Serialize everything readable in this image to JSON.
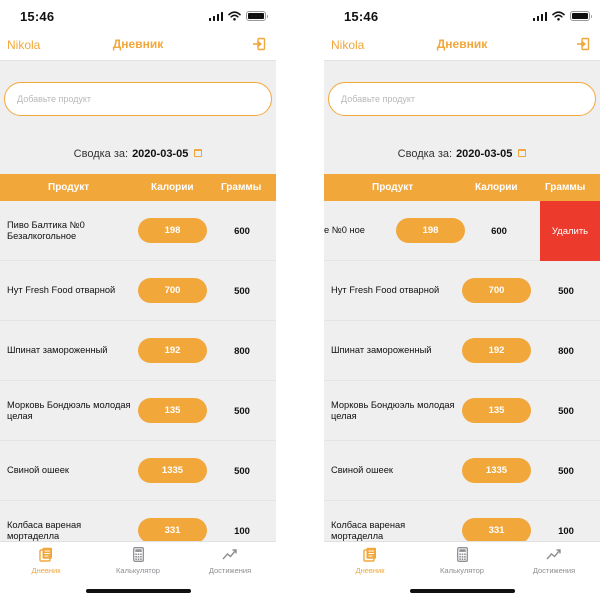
{
  "status_bar": {
    "time": "15:46"
  },
  "nav": {
    "user": "Nikola",
    "title": "Дневник"
  },
  "search": {
    "placeholder": "Добавьте продукт"
  },
  "summary": {
    "label": "Сводка за:",
    "date": "2020-03-05"
  },
  "table": {
    "headers": {
      "product": "Продукт",
      "calories": "Калории",
      "grams": "Граммы"
    }
  },
  "left_rows": [
    {
      "name": "Пиво Балтика №0 Безалкогольное",
      "calories": "198",
      "grams": "600"
    },
    {
      "name": "Нут Fresh Food отварной",
      "calories": "700",
      "grams": "500"
    },
    {
      "name": "Шпинат замороженный",
      "calories": "192",
      "grams": "800"
    },
    {
      "name": "Морковь Бондюэль молодая целая",
      "calories": "135",
      "grams": "500"
    },
    {
      "name": "Свиной ошеек",
      "calories": "1335",
      "grams": "500"
    },
    {
      "name": "Колбаса вареная мортаделла",
      "calories": "331",
      "grams": "100"
    }
  ],
  "right_rows": [
    {
      "name": "е №0 ное",
      "calories": "198",
      "grams": "600",
      "delete_label": "Удалить"
    },
    {
      "name": "Нут Fresh Food отварной",
      "calories": "700",
      "grams": "500"
    },
    {
      "name": "Шпинат замороженный",
      "calories": "192",
      "grams": "800"
    },
    {
      "name": "Морковь Бондюэль молодая целая",
      "calories": "135",
      "grams": "500"
    },
    {
      "name": "Свиной ошеек",
      "calories": "1335",
      "grams": "500"
    },
    {
      "name": "Колбаса вареная мортаделла",
      "calories": "331",
      "grams": "100"
    }
  ],
  "tabs": [
    {
      "label": "Дневник",
      "icon": "diary-icon",
      "active": true
    },
    {
      "label": "Калькулятор",
      "icon": "calculator-icon",
      "active": false
    },
    {
      "label": "Достижения",
      "icon": "achievements-icon",
      "active": false
    }
  ],
  "colors": {
    "accent": "#f2a73b",
    "delete": "#ec3a2c",
    "background": "#efeff0",
    "inactive_tab": "#8e8e93"
  }
}
